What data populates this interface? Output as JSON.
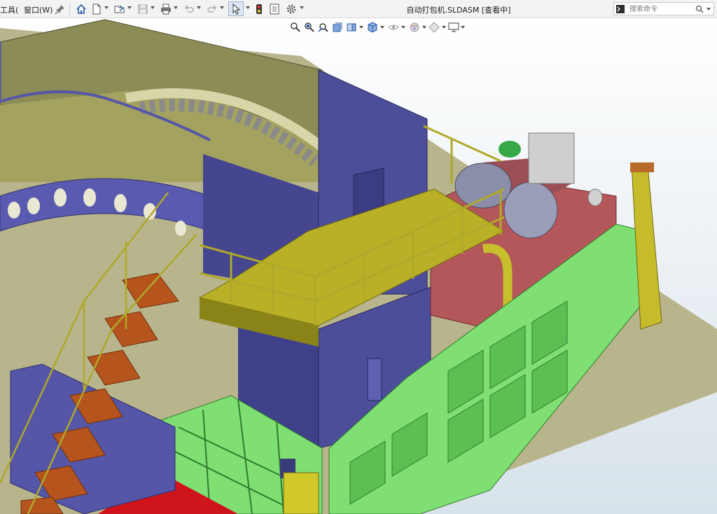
{
  "menu": {
    "tools_label": "工具(",
    "window_label": "窗口(W)"
  },
  "document": {
    "title": "自动打包机.SLDASM [查看中]"
  },
  "search": {
    "placeholder": "搜索命令"
  },
  "icons": {
    "pin": "pin-icon",
    "home": "home-icon",
    "new": "new-document-icon",
    "open": "open-folder-icon",
    "save": "save-icon",
    "print": "print-icon",
    "undo": "undo-icon",
    "redo": "redo-icon",
    "select": "select-cursor-icon",
    "rebuild": "traffic-light-rebuild-icon",
    "file_properties": "file-properties-icon",
    "options": "gear-options-icon",
    "command": "command-prompt-icon",
    "search": "magnifier-icon",
    "zoom_fit": "zoom-to-fit-icon",
    "zoom_area": "zoom-area-icon",
    "previous_view": "previous-view-icon",
    "section_view": "section-view-icon",
    "view_orientation": "view-orientation-icon",
    "display_style": "display-style-icon",
    "hide_show": "hide-show-items-icon",
    "appearance": "edit-appearance-icon",
    "scene": "apply-scene-icon",
    "view_settings": "view-settings-icon"
  },
  "colors": {
    "toolbar_bg": "#f3f3f3",
    "floor": "#b8b48c",
    "background_top": "#ffffff",
    "background_bottom": "#d7e2ea",
    "frame_green": "#7fdf72",
    "housing_blue": "#4d4e9a",
    "platform_yellow": "#b8b026",
    "tank_red": "#b3575a",
    "stairs_orange": "#b5541c",
    "motor_grey": "#8a8ea8",
    "hopper_olive": "#8c8c56"
  }
}
